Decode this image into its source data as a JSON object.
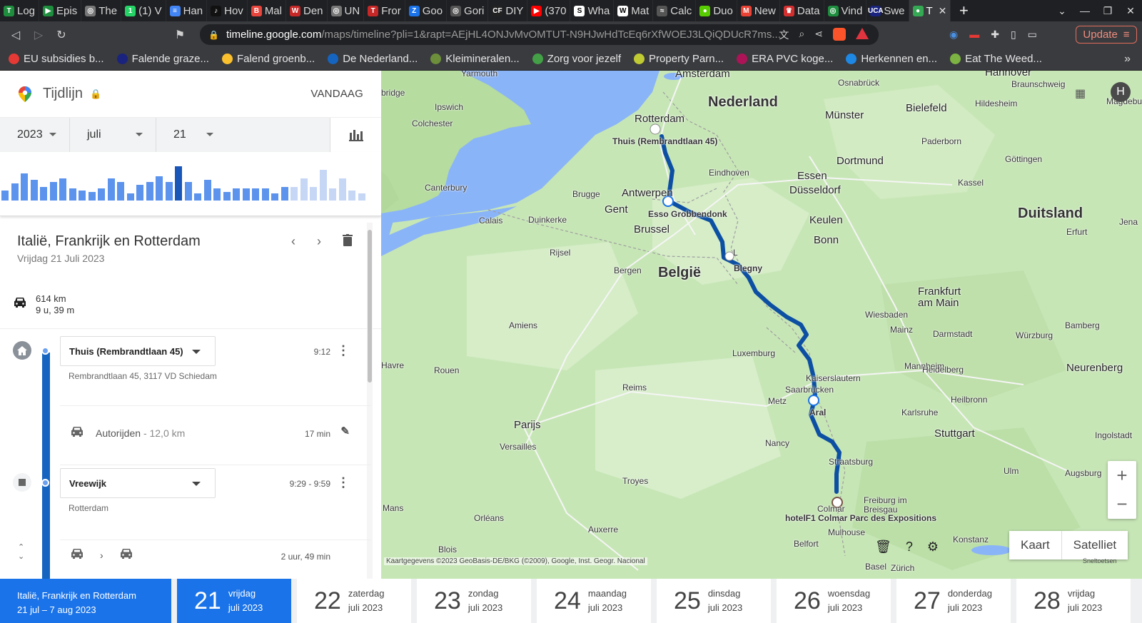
{
  "browser": {
    "tabs": [
      {
        "label": "Log",
        "color": "#1e8e3e",
        "glyph": "T"
      },
      {
        "label": "Epis",
        "color": "#1e8e3e",
        "glyph": "▶"
      },
      {
        "label": "The",
        "color": "#777777",
        "glyph": "◎"
      },
      {
        "label": "(1) V",
        "color": "#25d366",
        "glyph": "1"
      },
      {
        "label": "Han",
        "color": "#4285f4",
        "glyph": "≡"
      },
      {
        "label": "Hov",
        "color": "#111111",
        "glyph": "♪"
      },
      {
        "label": "Mal",
        "color": "#e8453c",
        "glyph": "B"
      },
      {
        "label": "Den",
        "color": "#c62828",
        "glyph": "W"
      },
      {
        "label": "UN",
        "color": "#777777",
        "glyph": "◎"
      },
      {
        "label": "Fror",
        "color": "#c62828",
        "glyph": "T"
      },
      {
        "label": "Goo",
        "color": "#1a73e8",
        "glyph": "Z"
      },
      {
        "label": "Gori",
        "color": "#555555",
        "glyph": "◎"
      },
      {
        "label": "DIY",
        "color": "#222222",
        "glyph": "CF"
      },
      {
        "label": "(370",
        "color": "#ff0000",
        "glyph": "▶"
      },
      {
        "label": "Wha",
        "color": "#ffffff",
        "glyph": "S"
      },
      {
        "label": "Mat",
        "color": "#ffffff",
        "glyph": "W"
      },
      {
        "label": "Calc",
        "color": "#555555",
        "glyph": "≈"
      },
      {
        "label": "Duo",
        "color": "#58cc02",
        "glyph": "●"
      },
      {
        "label": "New",
        "color": "#ea4335",
        "glyph": "M"
      },
      {
        "label": "Data",
        "color": "#d32f2f",
        "glyph": "♛"
      },
      {
        "label": "Vind",
        "color": "#1e8e3e",
        "glyph": "◎"
      },
      {
        "label": "Swe",
        "color": "#1a237e",
        "glyph": "UCA"
      },
      {
        "label": "T",
        "color": "#34a853",
        "glyph": "●",
        "active": true
      }
    ],
    "new_tab_label": "+",
    "url_host": "timeline.google.com",
    "url_path": "/maps/timeline?pli=1&rapt=AEjHL4ONJvMvOMTUT-N9HJwHdTcEq6rXfWOEJ3LQiQDUcR7ms...",
    "update_label": "Update",
    "bookmarks": [
      {
        "label": "EU subsidies b...",
        "color": "#e53935"
      },
      {
        "label": "Falende graze...",
        "color": "#1a237e"
      },
      {
        "label": "Falend groenb...",
        "color": "#fbc02d"
      },
      {
        "label": "De Nederland...",
        "color": "#1565c0"
      },
      {
        "label": "Kleimineralen...",
        "color": "#6d8f3c"
      },
      {
        "label": "Zorg voor jezelf",
        "color": "#43a047"
      },
      {
        "label": "Property Parn...",
        "color": "#c0ca33"
      },
      {
        "label": "ERA PVC koge...",
        "color": "#ad1457"
      },
      {
        "label": "Herkennen en...",
        "color": "#1e88e5"
      },
      {
        "label": "Eat The Weed...",
        "color": "#7cb342"
      }
    ]
  },
  "panel": {
    "app_title": "Tijdlijn",
    "today_label": "VANDAAG",
    "year": "2023",
    "month": "juli",
    "day": "21",
    "histogram": [
      0.3,
      0.5,
      0.8,
      0.6,
      0.4,
      0.55,
      0.65,
      0.35,
      0.3,
      0.25,
      0.35,
      0.65,
      0.55,
      0.2,
      0.45,
      0.55,
      0.7,
      0.55,
      1.0,
      0.55,
      0.2,
      0.6,
      0.35,
      0.25,
      0.35,
      0.35,
      0.35,
      0.35,
      0.2,
      0.4,
      0.4,
      0.65,
      0.4,
      0.9,
      0.35,
      0.65,
      0.3,
      0.2
    ],
    "histogram_selected_index": 18,
    "histogram_future_start": 30,
    "day_title": "Italië, Frankrijk en Rotterdam",
    "day_date": "Vrijdag 21 Juli 2023",
    "distance": "614 km",
    "duration": "9 u, 39 m",
    "entries": {
      "home_place": "Thuis (Rembrandtlaan 45)",
      "home_time": "9:12",
      "home_address": "Rembrandtlaan 45, 3117 VD Schiedam",
      "drive_label": "Autorijden",
      "drive_distance": "- 12,0 km",
      "drive_time": "17 min",
      "stop_place": "Vreewijk",
      "stop_time": "9:29 - 9:59",
      "stop_area": "Rotterdam",
      "next_time": "2 uur, 49 min"
    }
  },
  "map": {
    "labels": {
      "amsterdam": "Amsterdam",
      "nederland": "Nederland",
      "rotterdam": "Rotterdam",
      "thuis": "Thuis (Rembrandtlaan 45)",
      "yarmouth": "Yarmouth",
      "bridge": "bridge",
      "ipswich": "Ipswich",
      "colchester": "Colchester",
      "canterbury": "Canterbury",
      "calais": "Calais",
      "duinkerke": "Duinkerke",
      "brugge": "Brugge",
      "gent": "Gent",
      "antwerpen": "Antwerpen",
      "esso": "Esso Grobbendonk",
      "brussel": "Brussel",
      "rijsel": "Rijsel",
      "bergen": "Bergen",
      "belgie": "België",
      "blegny": "Blegny",
      "l": "L",
      "eindhoven": "Eindhoven",
      "essen": "Essen",
      "dusseldorf": "Düsseldorf",
      "dortmund": "Dortmund",
      "keulen": "Keulen",
      "bonn": "Bonn",
      "osnabruck": "Osnabrück",
      "munster": "Münster",
      "bielefeld": "Bielefeld",
      "paderborn": "Paderborn",
      "hannover": "Hannover",
      "braunschweig": "Braunschweig",
      "hildesheim": "Hildesheim",
      "magdeburg": "Magdeburg",
      "gottingen": "Göttingen",
      "kassel": "Kassel",
      "duitsland": "Duitsland",
      "erfurt": "Erfurt",
      "jena": "Jena",
      "frankfurt1": "Frankfurt",
      "frankfurt2": "am Main",
      "wiesbaden": "Wiesbaden",
      "mainz": "Mainz",
      "darmstadt": "Darmstadt",
      "wurzburg": "Würzburg",
      "bamberg": "Bamberg",
      "neurenberg": "Neurenberg",
      "mannheim": "Mannheim",
      "heidelberg": "Heidelberg",
      "heilbronn": "Heilbronn",
      "karlsruhe": "Karlsruhe",
      "stuttgart": "Stuttgart",
      "ingolstadt": "Ingolstadt",
      "ulm": "Ulm",
      "augsburg": "Augsburg",
      "konstanz": "Konstanz",
      "zurich": "Zürich",
      "luxemburg": "Luxemburg",
      "kaiserslautern": "Kaiserslautern",
      "saarbrucken": "Saarbrücken",
      "aral": "Aral",
      "metz": "Metz",
      "nancy": "Nancy",
      "straatsburg": "Straatsburg",
      "freiburg1": "Freiburg im",
      "freiburg2": "Breisgau",
      "colmar": "Colmar",
      "hotelf1": "hotelF1 Colmar Parc des Expositions",
      "mulhouse": "Mulhouse",
      "belfort": "Belfort",
      "basel": "Basel",
      "amiens": "Amiens",
      "reims": "Reims",
      "rouen": "Rouen",
      "havre": "Havre",
      "parijs": "Parijs",
      "versailles": "Versailles",
      "troyes": "Troyes",
      "auxerre": "Auxerre",
      "orleans": "Orléans",
      "blois": "Blois",
      "mans": "Mans"
    },
    "avatar_initial": "H",
    "zoom_in": "+",
    "zoom_out": "−",
    "type_map": "Kaart",
    "type_sat": "Satelliet",
    "copyright": "Kaartgegevens ©2023 GeoBasis-DE/BKG (©2009), Google, Inst. Geogr. Nacional",
    "shortcuts": "Sneltoetsen"
  },
  "strip": {
    "trip_title": "Italië, Frankrijk en Rotterdam",
    "trip_range": "21 jul – 7 aug 2023",
    "days": [
      {
        "num": "21",
        "weekday": "vrijdag",
        "month": "juli 2023",
        "selected": true
      },
      {
        "num": "22",
        "weekday": "zaterdag",
        "month": "juli 2023"
      },
      {
        "num": "23",
        "weekday": "zondag",
        "month": "juli 2023"
      },
      {
        "num": "24",
        "weekday": "maandag",
        "month": "juli 2023"
      },
      {
        "num": "25",
        "weekday": "dinsdag",
        "month": "juli 2023"
      },
      {
        "num": "26",
        "weekday": "woensdag",
        "month": "juli 2023"
      },
      {
        "num": "27",
        "weekday": "donderdag",
        "month": "juli 2023"
      },
      {
        "num": "28",
        "weekday": "vrijdag",
        "month": "juli 2023"
      }
    ]
  },
  "colors": {
    "accent": "#1a73e8",
    "route": "#0d4fa3",
    "histo_past": "#5b93ed",
    "histo_selected": "#1a56b8",
    "histo_future": "#c6d7f5",
    "land": "#c7e6b6",
    "water": "#8ab4f8"
  }
}
